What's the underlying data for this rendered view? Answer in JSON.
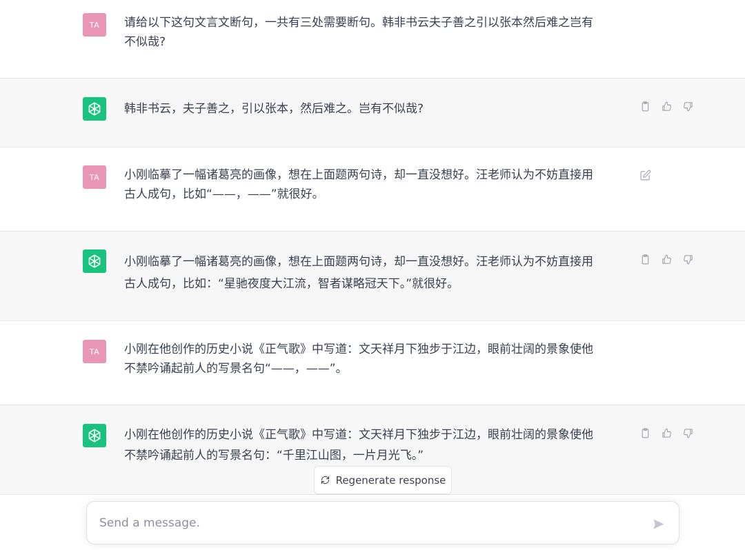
{
  "conversation": [
    {
      "role": "user",
      "avatar_label": "TA",
      "text": "请给以下这句文言文断句，一共有三处需要断句。韩非书云夫子善之引以张本然后难之岂有\n不似哉?"
    },
    {
      "role": "assistant",
      "text": "韩非书云，夫子善之，引以张本，然后难之。岂有不似哉?"
    },
    {
      "role": "user",
      "avatar_label": "TA",
      "text": "小刚临摹了一幅诸葛亮的画像，想在上面题两句诗，却一直没想好。汪老师认为不妨直接用\n古人成句，比如“——，——”就很好。"
    },
    {
      "role": "assistant",
      "text": "小刚临摹了一幅诸葛亮的画像，想在上面题两句诗，却一直没想好。汪老师认为不妨直接用\n古人成句，比如：“星驰夜度大江流，智者谋略冠天下。”就很好。"
    },
    {
      "role": "user",
      "avatar_label": "TA",
      "text": "小刚在他创作的历史小说《正气歌》中写道：文天祥月下独步于江边，眼前壮阔的景象使他\n不禁吟诵起前人的写景名句“——，——”。"
    },
    {
      "role": "assistant",
      "text": "小刚在他创作的历史小说《正气歌》中写道：文天祥月下独步于江边，眼前壮阔的景象使他\n不禁吟诵起前人的写景名句：“千里江山图，一片月光飞。”"
    }
  ],
  "regenerate_label": "Regenerate response",
  "composer": {
    "placeholder": "Send a message."
  },
  "colors": {
    "user_avatar": "#e996b6",
    "assistant_avatar": "#19c37d",
    "assistant_bg": "#f7f7f8"
  },
  "icons": {
    "copy": "clipboard-icon",
    "like": "thumbs-up-icon",
    "dislike": "thumbs-down-icon",
    "edit": "edit-icon",
    "regenerate": "refresh-icon",
    "send": "send-icon"
  }
}
